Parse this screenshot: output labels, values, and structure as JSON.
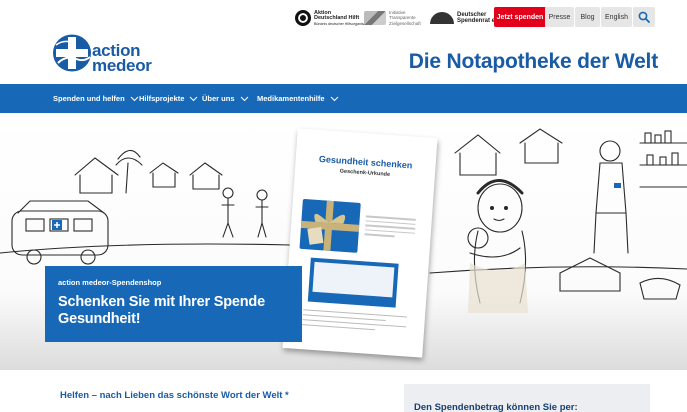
{
  "topbar": {
    "partners": [
      {
        "name_line1": "Aktion",
        "name_line2": "Deutschland Hilft",
        "small": "Bündnis deutscher Hilfsorganisationen"
      },
      {
        "name_line1": "Initiative",
        "name_line2": "Transparente",
        "small": "Zivilgesellschaft"
      },
      {
        "name_line1": "Deutscher",
        "name_line2": "Spendenrat e.V.",
        "small": ""
      }
    ],
    "donate_label": "Jetzt spenden",
    "press_label": "Presse",
    "blog_label": "Blog",
    "language_label": "English",
    "search_icon": "search-icon"
  },
  "brand": {
    "logo_word1": "action",
    "logo_word2": "medeor",
    "tagline": "Die Notapotheke der Welt",
    "color": "#1a5ba6"
  },
  "nav": {
    "items": [
      {
        "label": "Spenden und helfen"
      },
      {
        "label": "Hilfsprojekte"
      },
      {
        "label": "Über uns"
      },
      {
        "label": "Medikamentenhilfe"
      }
    ],
    "background": "#1769b8"
  },
  "hero": {
    "certificate_title": "Gesundheit schenken",
    "certificate_subtitle": "Geschenk-Urkunde",
    "promo_kicker": "action medeor-Spendenshop",
    "promo_headline": "Schenken Sie mit Ihrer Spende Gesundheit!"
  },
  "content": {
    "intro_heading": "Helfen – nach Lieben das schönste Wort der Welt *",
    "aside_heading": "Den Spendenbetrag können Sie per:"
  },
  "colors": {
    "accent": "#1769b8",
    "donate": "#e2001a"
  }
}
